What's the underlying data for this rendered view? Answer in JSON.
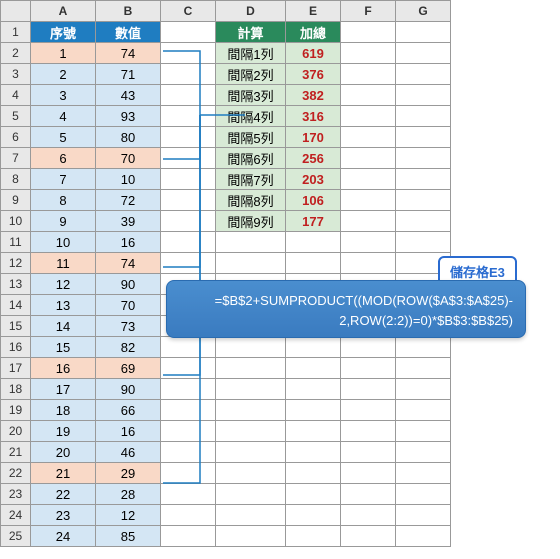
{
  "cols": [
    "A",
    "B",
    "C",
    "D",
    "E",
    "F",
    "G"
  ],
  "header_ab": {
    "a": "序號",
    "b": "數值"
  },
  "header_de": {
    "d": "計算",
    "e": "加總"
  },
  "rows_ab": [
    {
      "n": "1",
      "v": "74",
      "hl": true
    },
    {
      "n": "2",
      "v": "71"
    },
    {
      "n": "3",
      "v": "43"
    },
    {
      "n": "4",
      "v": "93"
    },
    {
      "n": "5",
      "v": "80"
    },
    {
      "n": "6",
      "v": "70",
      "hl": true
    },
    {
      "n": "7",
      "v": "10"
    },
    {
      "n": "8",
      "v": "72"
    },
    {
      "n": "9",
      "v": "39"
    },
    {
      "n": "10",
      "v": "16"
    },
    {
      "n": "11",
      "v": "74",
      "hl": true
    },
    {
      "n": "12",
      "v": "90"
    },
    {
      "n": "13",
      "v": "70"
    },
    {
      "n": "14",
      "v": "73"
    },
    {
      "n": "15",
      "v": "82"
    },
    {
      "n": "16",
      "v": "69",
      "hl": true
    },
    {
      "n": "17",
      "v": "90"
    },
    {
      "n": "18",
      "v": "66"
    },
    {
      "n": "19",
      "v": "16"
    },
    {
      "n": "20",
      "v": "46"
    },
    {
      "n": "21",
      "v": "29",
      "hl": true
    },
    {
      "n": "22",
      "v": "28"
    },
    {
      "n": "23",
      "v": "12"
    },
    {
      "n": "24",
      "v": "85"
    }
  ],
  "rows_de": [
    {
      "d": "間隔1列",
      "e": "619"
    },
    {
      "d": "間隔2列",
      "e": "376"
    },
    {
      "d": "間隔3列",
      "e": "382"
    },
    {
      "d": "間隔4列",
      "e": "316"
    },
    {
      "d": "間隔5列",
      "e": "170"
    },
    {
      "d": "間隔6列",
      "e": "256"
    },
    {
      "d": "間隔7列",
      "e": "203"
    },
    {
      "d": "間隔8列",
      "e": "106"
    },
    {
      "d": "間隔9列",
      "e": "177"
    }
  ],
  "callout": {
    "label": "儲存格E3",
    "line1": "=$B$2+SUMPRODUCT((MOD(ROW($A$3:$A$25)-",
    "line2": "2,ROW(2:2))=0)*$B$3:$B$25)"
  }
}
